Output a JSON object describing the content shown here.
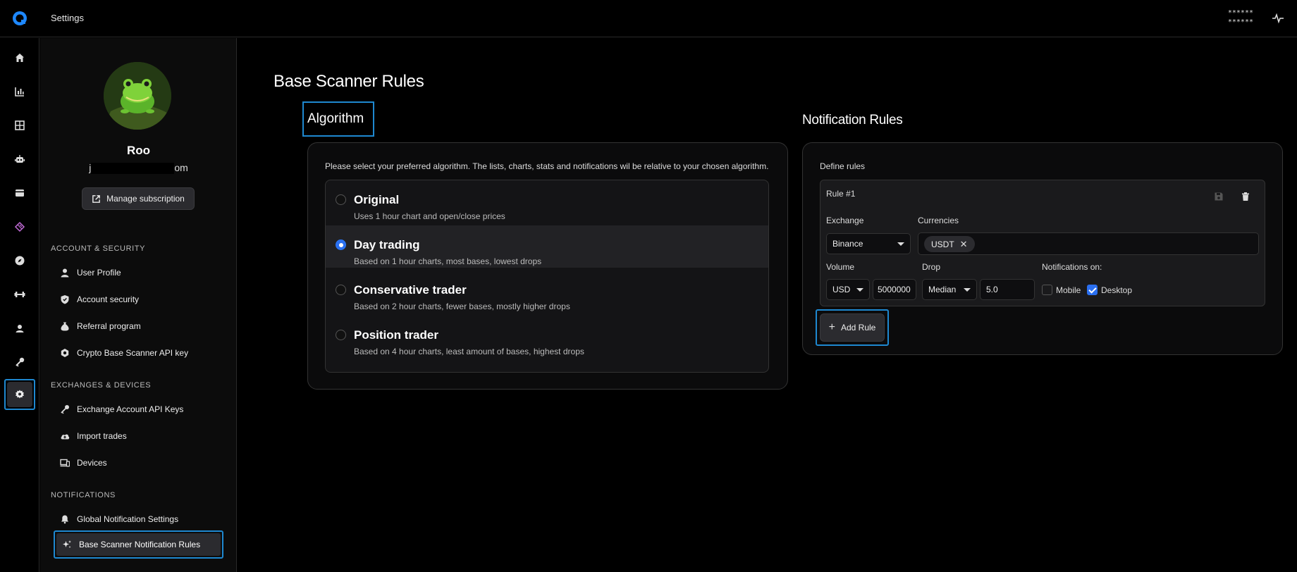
{
  "header": {
    "title": "Settings",
    "masked_line1": "******",
    "masked_line2": "******"
  },
  "rail": {
    "icons": [
      "home-icon",
      "chart-icon",
      "grid-icon",
      "robot-icon",
      "wallet-icon",
      "stack-icon",
      "compass-icon",
      "barbell-icon",
      "user-badge-icon",
      "key-icon",
      "gear-icon"
    ],
    "active": "gear-icon",
    "accent": "#1e88d0"
  },
  "profile": {
    "name": "Roo",
    "email_prefix": "j",
    "email_suffix": "om",
    "manage_label": "Manage subscription"
  },
  "nav": {
    "account_heading": "ACCOUNT & SECURITY",
    "account_items": [
      "User Profile",
      "Account security",
      "Referral program",
      "Crypto Base Scanner API key"
    ],
    "exchanges_heading": "EXCHANGES & DEVICES",
    "exchanges_items": [
      "Exchange Account API Keys",
      "Import trades",
      "Devices"
    ],
    "notifications_heading": "NOTIFICATIONS",
    "notifications_items": [
      "Global Notification Settings",
      "Base Scanner Notification Rules"
    ]
  },
  "main": {
    "page_title": "Base Scanner Rules",
    "algorithm": {
      "title": "Algorithm",
      "description": "Please select your preferred algorithm. The lists, charts, stats and notifications wil be relative to your chosen algorithm.",
      "options": [
        {
          "title": "Original",
          "subtitle": "Uses 1 hour chart and open/close prices",
          "selected": false
        },
        {
          "title": "Day trading",
          "subtitle": "Based on 1 hour charts, most bases, lowest drops",
          "selected": true
        },
        {
          "title": "Conservative trader",
          "subtitle": "Based on 2 hour charts, fewer bases, mostly higher drops",
          "selected": false
        },
        {
          "title": "Position trader",
          "subtitle": "Based on 4 hour charts, least amount of bases, highest drops",
          "selected": false
        }
      ]
    },
    "notification_rules": {
      "title": "Notification Rules",
      "define_label": "Define rules",
      "rule": {
        "title": "Rule #1",
        "exchange_label": "Exchange",
        "exchange_value": "Binance",
        "currencies_label": "Currencies",
        "currencies": [
          "USDT"
        ],
        "volume_label": "Volume",
        "volume_currency": "USD",
        "volume_amount": "5000000",
        "drop_label": "Drop",
        "drop_method": "Median",
        "drop_value": "5.0",
        "notifications_label": "Notifications on:",
        "mobile_label": "Mobile",
        "mobile_checked": false,
        "desktop_label": "Desktop",
        "desktop_checked": true
      },
      "add_rule_label": "Add Rule"
    }
  }
}
